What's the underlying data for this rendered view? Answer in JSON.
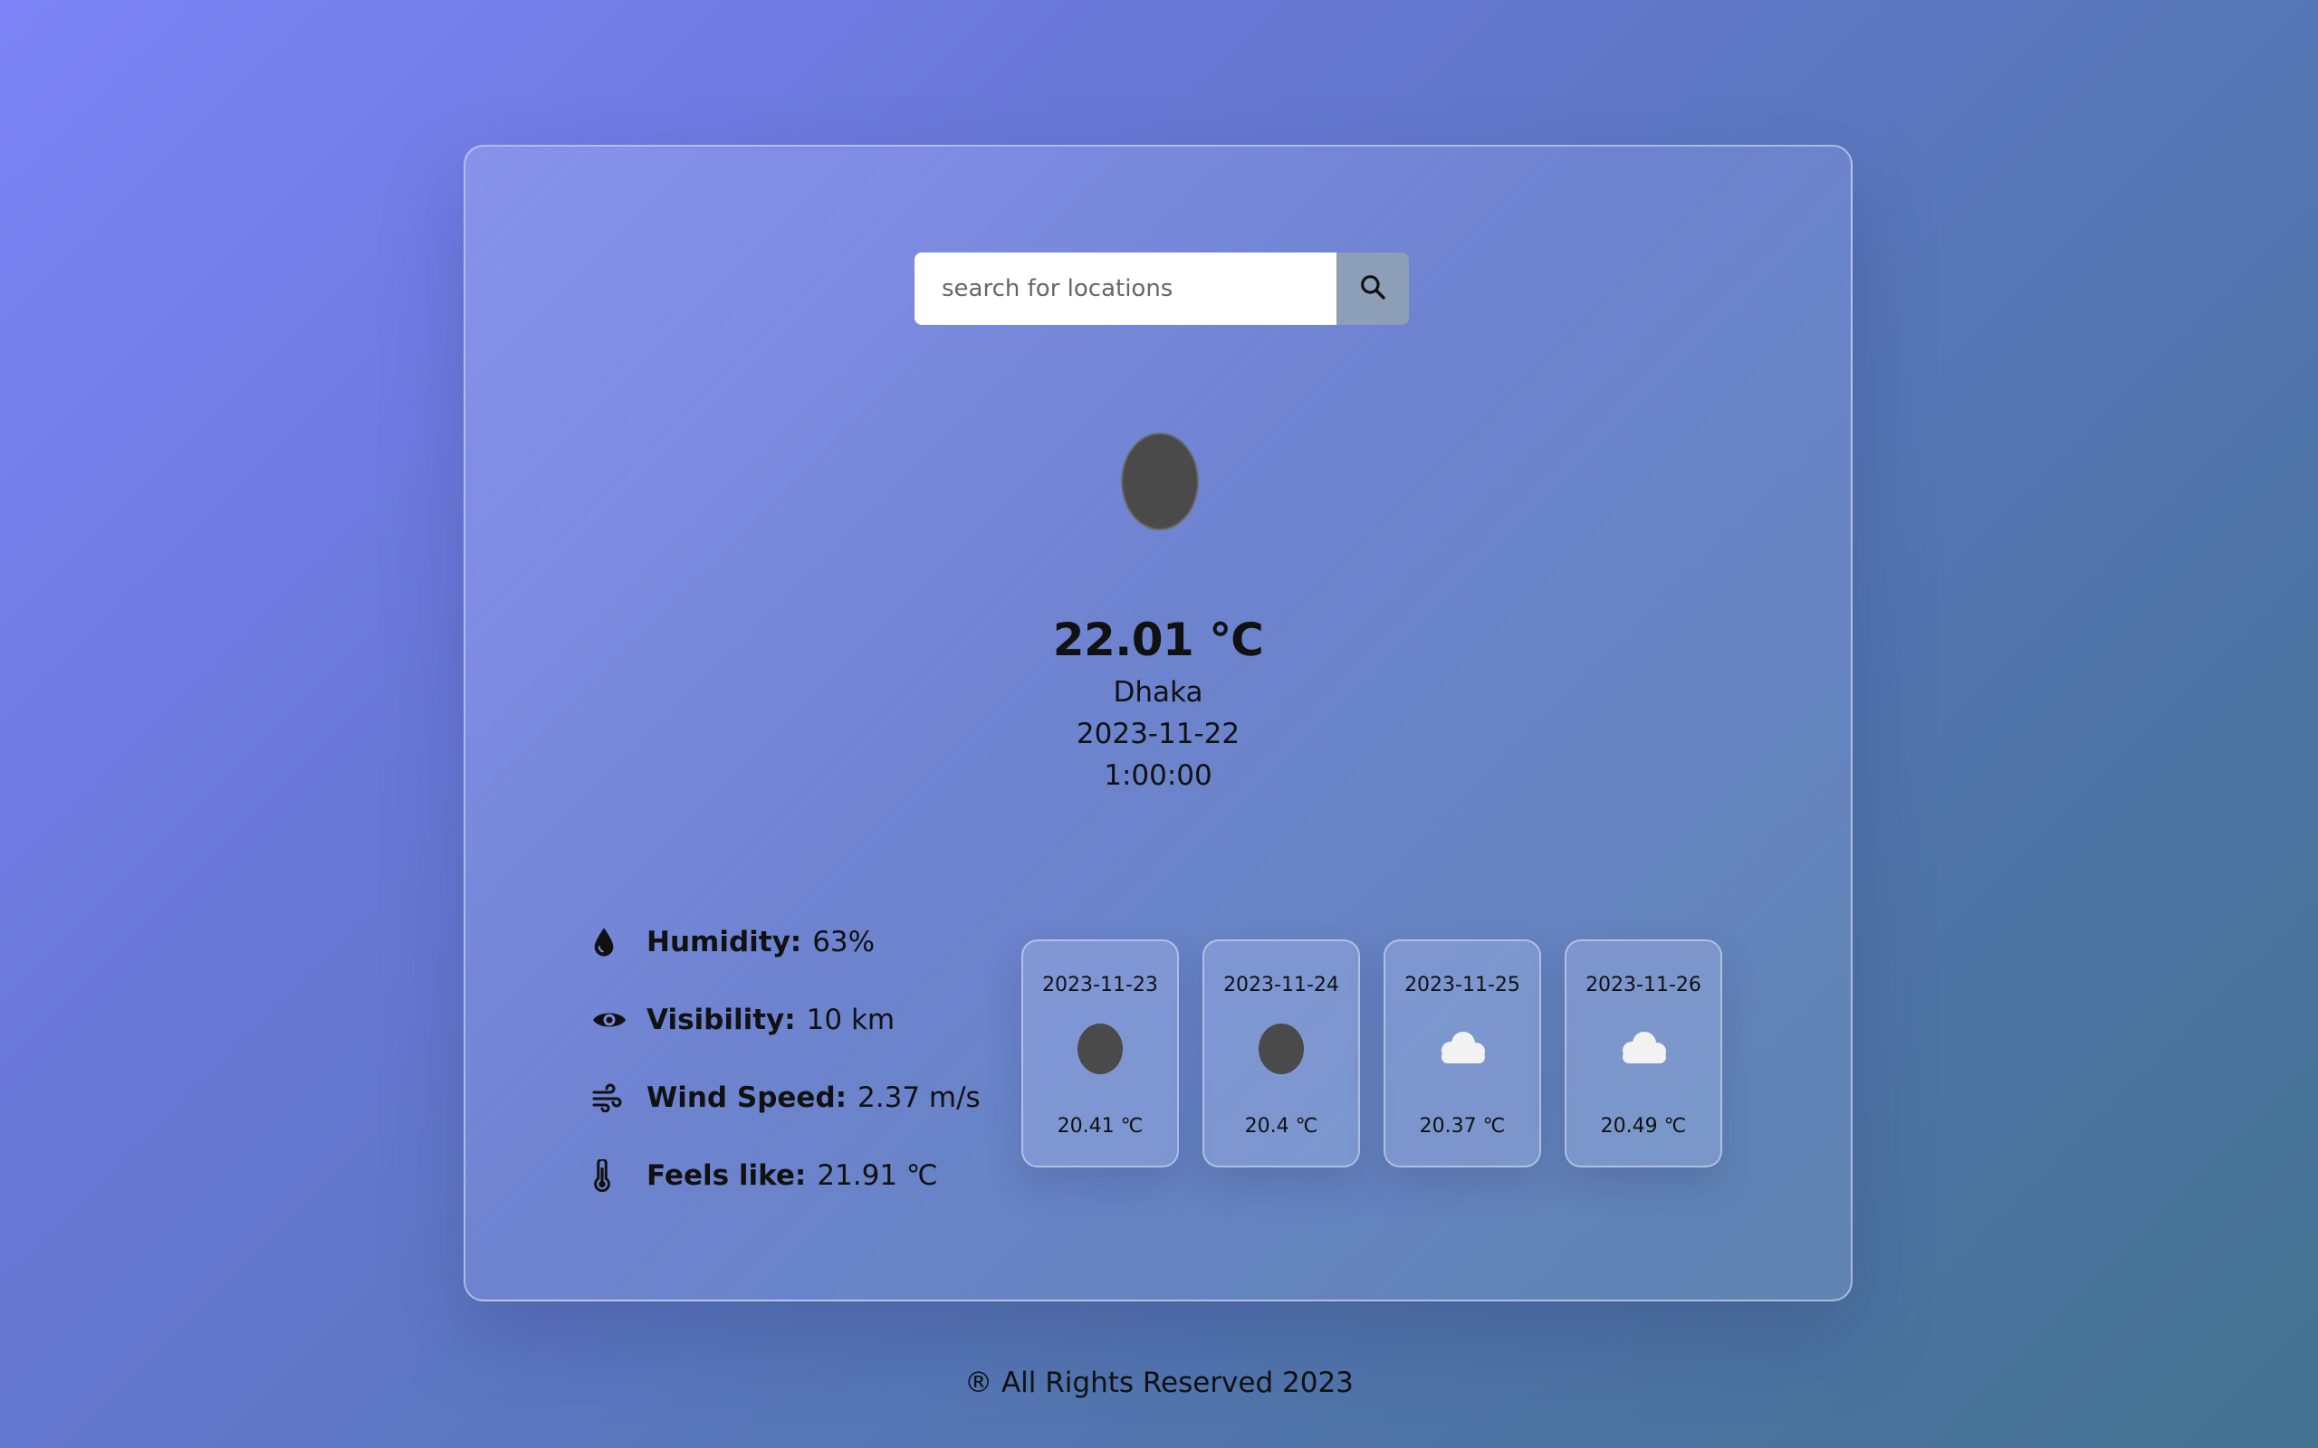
{
  "search": {
    "placeholder": "search for locations",
    "value": "",
    "icon": "search-icon"
  },
  "current": {
    "icon": "moon-icon",
    "temperature": "22.01 ℃",
    "city": "Dhaka",
    "date": "2023-11-22",
    "time": "1:00:00"
  },
  "details": [
    {
      "icon": "droplet-icon",
      "label": "Humidity:",
      "value": "63%"
    },
    {
      "icon": "eye-icon",
      "label": "Visibility:",
      "value": "10 km"
    },
    {
      "icon": "wind-icon",
      "label": "Wind Speed:",
      "value": "2.37 m/s"
    },
    {
      "icon": "thermometer-icon",
      "label": "Feels like:",
      "value": "21.91 ℃"
    }
  ],
  "forecast": [
    {
      "date": "2023-11-23",
      "icon": "moon-icon",
      "temp": "20.41 ℃"
    },
    {
      "date": "2023-11-24",
      "icon": "moon-icon",
      "temp": "20.4 ℃"
    },
    {
      "date": "2023-11-25",
      "icon": "cloud-icon",
      "temp": "20.37 ℃"
    },
    {
      "date": "2023-11-26",
      "icon": "cloud-icon",
      "temp": "20.49 ℃"
    }
  ],
  "footer": {
    "text": "® All Rights Reserved 2023"
  },
  "colors": {
    "background_start": "#7e84f7",
    "background_end": "#44728f",
    "search_button": "#8d9fb6",
    "moon": "#4a4a4a",
    "cloud": "#f2f2f2"
  }
}
